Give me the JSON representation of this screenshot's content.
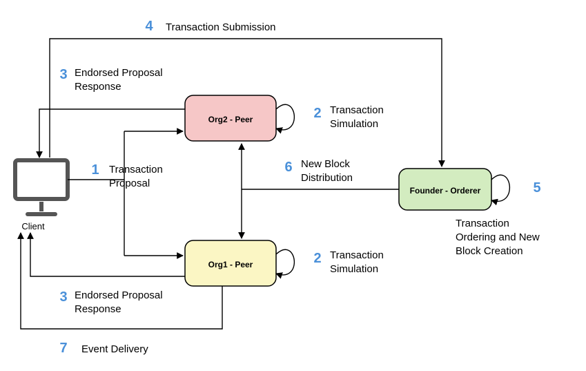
{
  "client": {
    "label": "Client"
  },
  "nodes": {
    "org2": {
      "label": "Org2 - Peer"
    },
    "org1": {
      "label": "Org1 - Peer"
    },
    "orderer": {
      "label": "Founder - Orderer"
    }
  },
  "steps": {
    "s1": {
      "num": "1",
      "text_l1": "Transaction",
      "text_l2": "Proposal"
    },
    "s2a": {
      "num": "2",
      "text_l1": "Transaction",
      "text_l2": "Simulation"
    },
    "s2b": {
      "num": "2",
      "text_l1": "Transaction",
      "text_l2": "Simulation"
    },
    "s3a": {
      "num": "3",
      "text_l1": "Endorsed Proposal",
      "text_l2": "Response"
    },
    "s3b": {
      "num": "3",
      "text_l1": "Endorsed Proposal",
      "text_l2": "Response"
    },
    "s4": {
      "num": "4",
      "text_l1": "Transaction Submission"
    },
    "s5": {
      "num": "5",
      "text_l1": "Transaction",
      "text_l2": "Ordering and New",
      "text_l3": "Block Creation"
    },
    "s6": {
      "num": "6",
      "text_l1": "New Block",
      "text_l2": "Distribution"
    },
    "s7": {
      "num": "7",
      "text_l1": "Event Delivery"
    }
  }
}
